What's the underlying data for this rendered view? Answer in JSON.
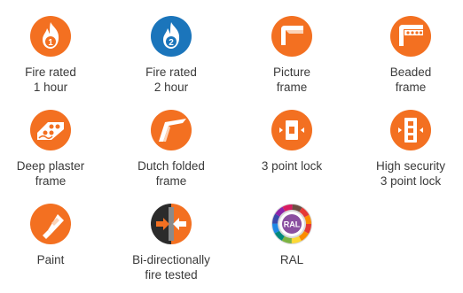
{
  "colors": {
    "orange": "#F37021",
    "blue": "#1B75BB",
    "text": "#3a3a3a"
  },
  "features": [
    {
      "icon": "fire-rated-1-hour-icon",
      "line1": "Fire rated",
      "line2": "1 hour",
      "badge": "1"
    },
    {
      "icon": "fire-rated-2-hour-icon",
      "line1": "Fire rated",
      "line2": "2 hour",
      "badge": "2"
    },
    {
      "icon": "picture-frame-icon",
      "line1": "Picture",
      "line2": "frame"
    },
    {
      "icon": "beaded-frame-icon",
      "line1": "Beaded",
      "line2": "frame"
    },
    {
      "icon": "deep-plaster-frame-icon",
      "line1": "Deep plaster",
      "line2": "frame"
    },
    {
      "icon": "dutch-folded-frame-icon",
      "line1": "Dutch folded",
      "line2": "frame"
    },
    {
      "icon": "3-point-lock-icon",
      "line1": "3 point lock",
      "line2": ""
    },
    {
      "icon": "high-security-3-point-lock-icon",
      "line1": "High security",
      "line2": "3 point lock"
    },
    {
      "icon": "paint-icon",
      "line1": "Paint",
      "line2": ""
    },
    {
      "icon": "bi-directionally-fire-tested-icon",
      "line1": "Bi-directionally",
      "line2": "fire tested"
    },
    {
      "icon": "ral-icon",
      "line1": "RAL",
      "line2": "",
      "badge": "RAL"
    }
  ]
}
